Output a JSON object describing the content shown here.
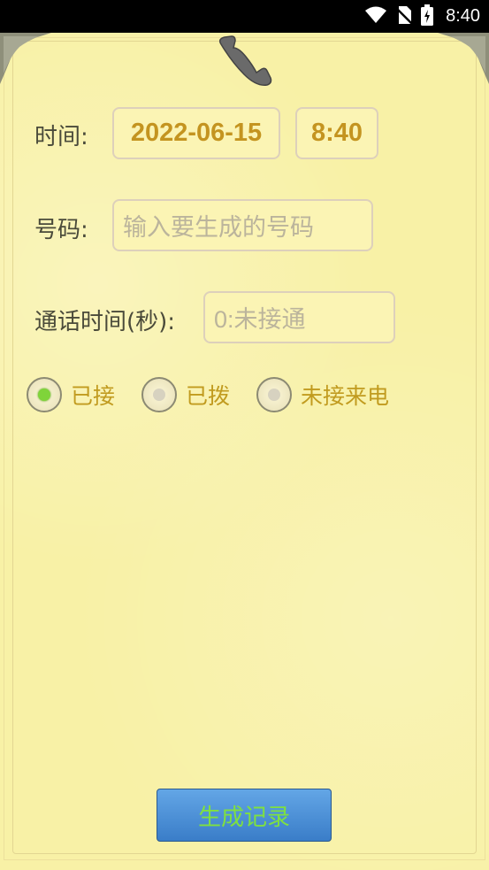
{
  "status_bar": {
    "time": "8:40",
    "icons": [
      "wifi-icon",
      "no-sim-icon",
      "battery-charging-icon"
    ]
  },
  "form": {
    "time_label": "时间:",
    "date_value": "2022-06-15",
    "time_value": "8:40",
    "number_label": "号码:",
    "number_placeholder": "输入要生成的号码",
    "duration_label": "通话时间(秒):",
    "duration_placeholder": "0:未接通"
  },
  "call_type": {
    "options": [
      {
        "label": "已接",
        "checked": true
      },
      {
        "label": "已拨",
        "checked": false
      },
      {
        "label": "未接来电",
        "checked": false
      }
    ]
  },
  "generate_button_label": "生成记录",
  "colors": {
    "paper": "#f8f1a6",
    "accent_text": "#c49420",
    "button_blue": "#3a7dc8",
    "button_text": "#7fe040",
    "checked_radio": "#7fd43a"
  }
}
